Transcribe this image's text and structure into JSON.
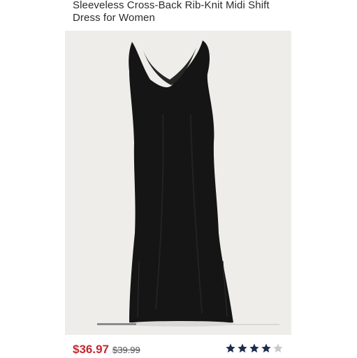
{
  "product": {
    "title": "Sleeveless Cross-Back Rib-Knit Midi Shift Dress for Women",
    "image_icon": "black-midi-dress-photo"
  },
  "pricing": {
    "sale_price": "$36.97",
    "regular_price": "$39.99",
    "sale_color": "#c5282f"
  },
  "rating": {
    "value": 4,
    "max": 5,
    "filled_color": "#1f2d4d",
    "empty_color": "#c9c9c9"
  },
  "carousel": {
    "current_index_fraction": 0.2
  }
}
